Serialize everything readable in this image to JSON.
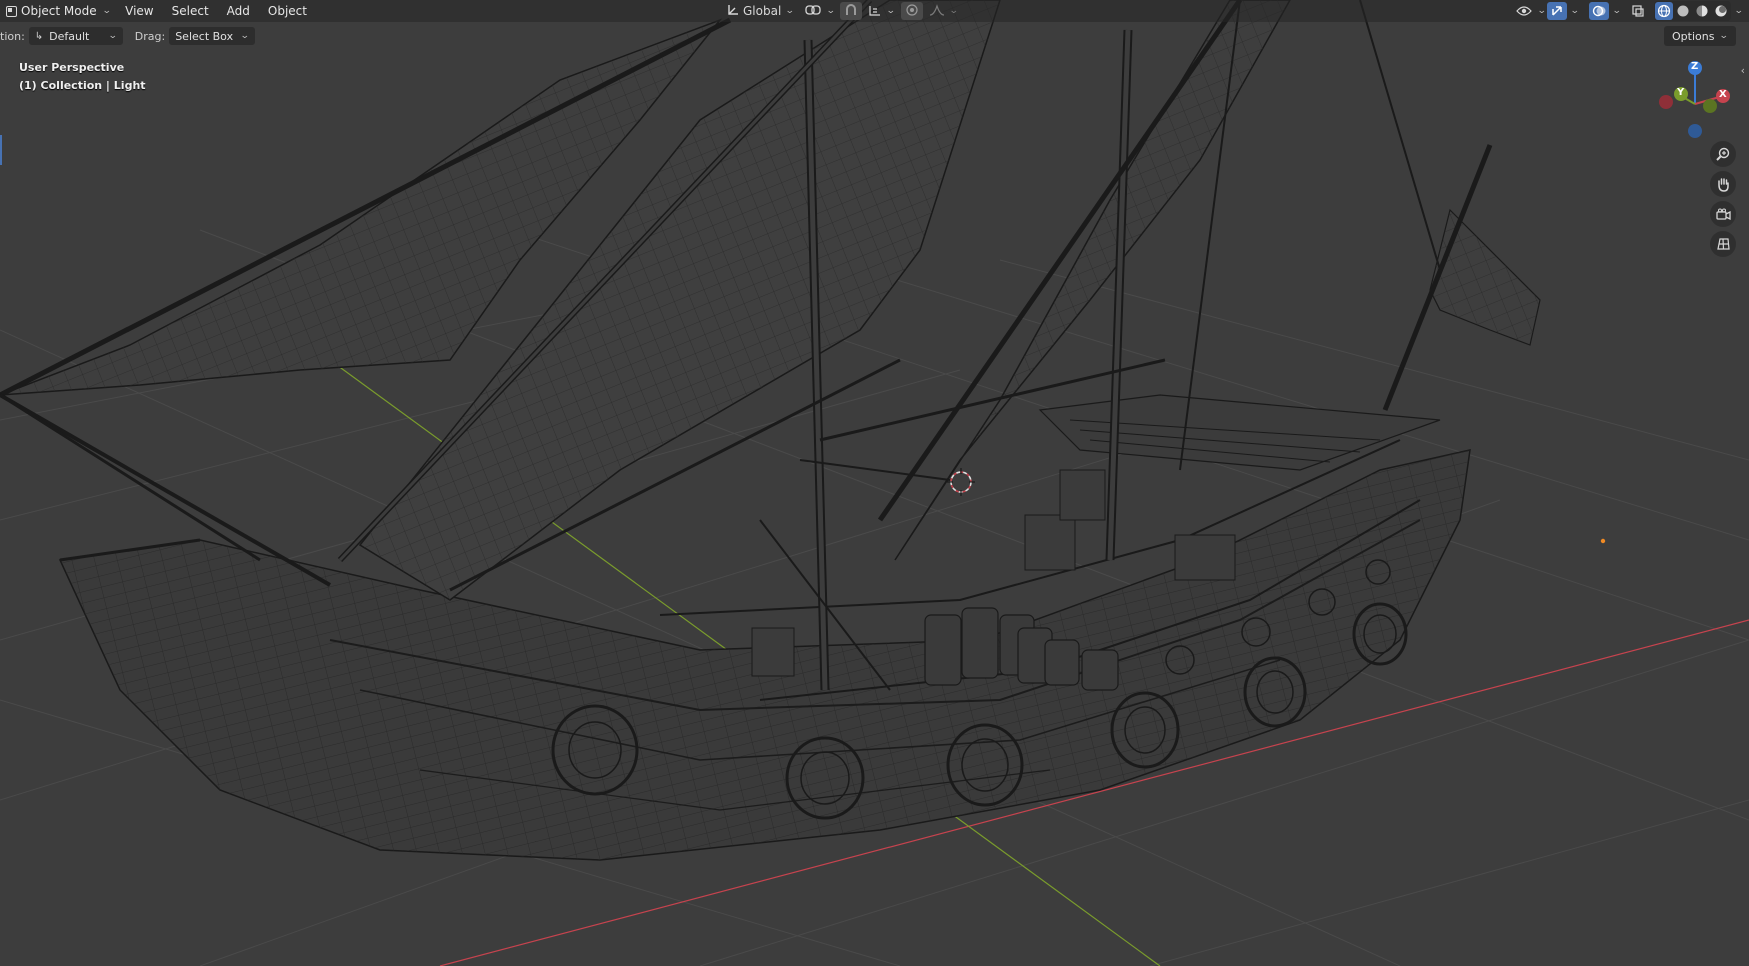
{
  "header": {
    "mode_label": "Object Mode",
    "menus": [
      "View",
      "Select",
      "Add",
      "Object"
    ],
    "transform_orientation": "Global"
  },
  "toolbar": {
    "orientation_label": "tion:",
    "orientation_value": "Default",
    "drag_label": "Drag:",
    "drag_value": "Select Box",
    "options_label": "Options"
  },
  "viewport": {
    "perspective_label": "User Perspective",
    "collection_label": "(1) Collection | Light"
  },
  "gizmo": {
    "x_label": "X",
    "y_label": "Y",
    "z_label": "Z"
  },
  "colors": {
    "background": "#3d3d3d",
    "x_axis": "#c6434e",
    "y_axis": "#7a9c2c",
    "z_axis": "#3b7cd6",
    "accent": "#4772b3",
    "wire": "#1a1a1a"
  },
  "icons": [
    "object-mode-icon",
    "global-orientation-icon",
    "pivot-icon",
    "snap-icon",
    "proportional-edit-icon",
    "visibility-icon",
    "gizmo-icon",
    "overlay-icon",
    "xray-icon",
    "wireframe-shading-icon",
    "solid-shading-icon",
    "material-shading-icon",
    "rendered-shading-icon",
    "zoom-icon",
    "pan-hand-icon",
    "camera-icon",
    "grid-icon"
  ]
}
